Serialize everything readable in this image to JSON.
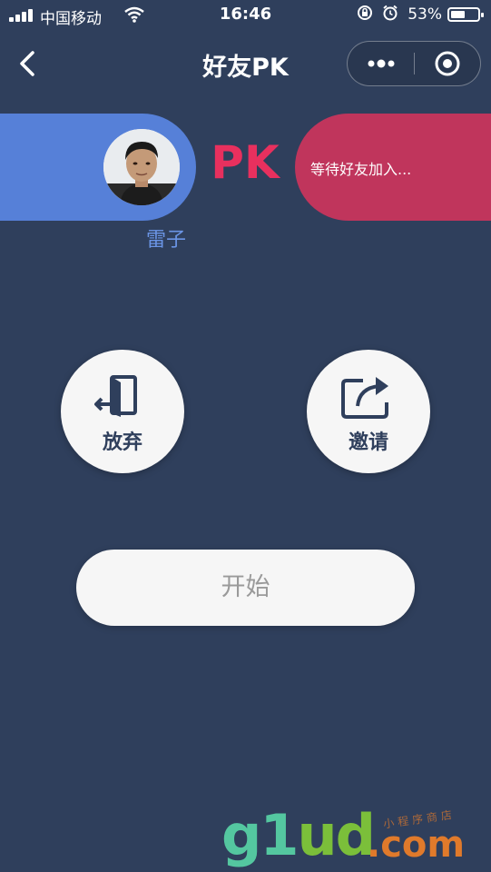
{
  "status_bar": {
    "carrier": "中国移动",
    "time": "16:46",
    "battery_percent": "53%",
    "battery_level": 0.53
  },
  "nav": {
    "title": "好友PK"
  },
  "pk": {
    "player_name": "雷子",
    "versus_label": "PK",
    "waiting_text": "等待好友加入..."
  },
  "actions": {
    "give_up_label": "放弃",
    "invite_label": "邀请",
    "start_label": "开始"
  },
  "watermark": {
    "main_g": "g",
    "main_1": "1",
    "main_ud": "ud",
    "main_com": ".com",
    "sub": "小程序商店"
  },
  "colors": {
    "background": "#2f3f5c",
    "player_blue": "#5680d8",
    "opponent_red": "#c0355c",
    "pk_pink": "#e8305e"
  }
}
